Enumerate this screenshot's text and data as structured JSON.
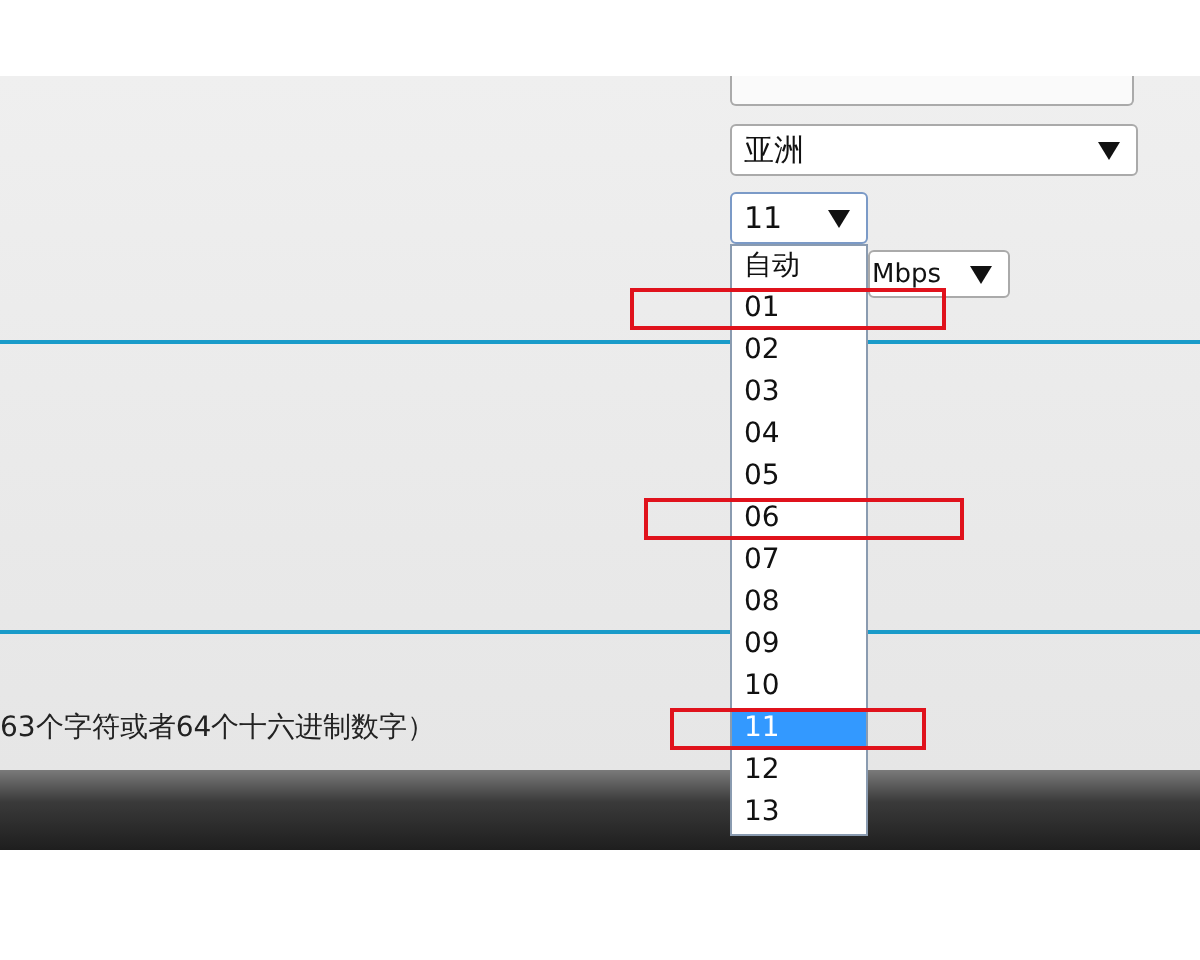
{
  "region_select": {
    "value": "亚洲"
  },
  "channel_select": {
    "value": "11",
    "expanded": true,
    "options": [
      {
        "label": "自动",
        "selected": false,
        "annotated": false
      },
      {
        "label": "01",
        "selected": false,
        "annotated": true
      },
      {
        "label": "02",
        "selected": false,
        "annotated": false
      },
      {
        "label": "03",
        "selected": false,
        "annotated": false
      },
      {
        "label": "04",
        "selected": false,
        "annotated": false
      },
      {
        "label": "05",
        "selected": false,
        "annotated": false
      },
      {
        "label": "06",
        "selected": false,
        "annotated": true
      },
      {
        "label": "07",
        "selected": false,
        "annotated": false
      },
      {
        "label": "08",
        "selected": false,
        "annotated": false
      },
      {
        "label": "09",
        "selected": false,
        "annotated": false
      },
      {
        "label": "10",
        "selected": false,
        "annotated": false
      },
      {
        "label": "11",
        "selected": true,
        "annotated": true
      },
      {
        "label": "12",
        "selected": false,
        "annotated": false
      },
      {
        "label": "13",
        "selected": false,
        "annotated": false
      }
    ]
  },
  "rate_select": {
    "value": "Mbps"
  },
  "note": "63个字符或者64个十六进制数字）"
}
